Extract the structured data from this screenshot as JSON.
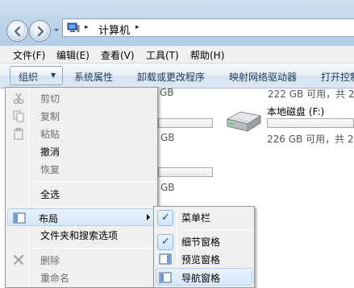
{
  "address": {
    "path_label": "计算机",
    "separator_glyph": "▸"
  },
  "menubar": [
    "文件(F)",
    "编辑(E)",
    "查看(V)",
    "工具(T)",
    "帮助(H)"
  ],
  "commandbar": {
    "organize": "组织",
    "items": [
      "系统属性",
      "卸载或更改程序",
      "映射网络驱动器",
      "打开控制"
    ]
  },
  "content": {
    "drive_label": "本地磁盘 (F:)",
    "free_top_right": "222 GB 可用，共 2",
    "free_f": "226 GB 可用，共 2",
    "gb_1": "GB",
    "gb_2": "GB",
    "gb_3": "GB",
    "gb_top_partial": "GB"
  },
  "organize_menu": {
    "items": [
      {
        "label": "剪切",
        "icon": "scissors-icon",
        "disabled": true
      },
      {
        "label": "复制",
        "icon": "copy-icon",
        "disabled": true
      },
      {
        "label": "粘贴",
        "icon": "paste-icon",
        "disabled": true
      },
      {
        "label": "撤消",
        "icon": "",
        "disabled": false
      },
      {
        "label": "恢复",
        "icon": "",
        "disabled": true
      },
      {
        "label": "全选",
        "icon": "",
        "disabled": false
      },
      {
        "label": "布局",
        "icon": "layout-icon",
        "disabled": false
      },
      {
        "label": "文件夹和搜索选项",
        "icon": "",
        "disabled": false
      },
      {
        "label": "删除",
        "icon": "delete-icon",
        "disabled": true
      },
      {
        "label": "重命名",
        "icon": "",
        "disabled": true
      }
    ]
  },
  "layout_submenu": {
    "items": [
      {
        "label": "菜单栏",
        "checked": true
      },
      {
        "label": "细节窗格",
        "checked": true
      },
      {
        "label": "预览窗格",
        "checked": false
      },
      {
        "label": "导航窗格",
        "checked": false
      }
    ]
  },
  "colors": {
    "accent": "#1e395b",
    "highlight": "#d6e7f8",
    "menu_bg": "#f0f0f0"
  }
}
